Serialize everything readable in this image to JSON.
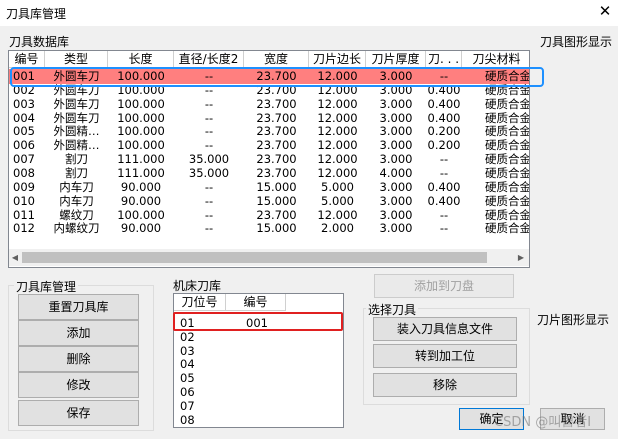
{
  "window": {
    "title": "刀具库管理",
    "close_glyph": "✕"
  },
  "labels": {
    "tool_database": "刀具数据库",
    "tool_graphic": "刀具图形显示",
    "blade_graphic": "刀片图形显示",
    "library_group": "刀具库管理",
    "machine_library": "机床刀库",
    "select_tool_group": "选择刀具"
  },
  "tool_table": {
    "headers": [
      "编号",
      "类型",
      "长度",
      "直径/长度2",
      "宽度",
      "刀片边长",
      "刀片厚度",
      "刀. . .",
      "刀尖材料"
    ],
    "rows": [
      [
        "001",
        "外圆车刀",
        "100.000",
        "--",
        "23.700",
        "12.000",
        "3.000",
        "--",
        "硬质合金"
      ],
      [
        "002",
        "外圆车刀",
        "100.000",
        "--",
        "23.700",
        "12.000",
        "3.000",
        "0.400",
        "硬质合金"
      ],
      [
        "003",
        "外圆车刀",
        "100.000",
        "--",
        "23.700",
        "12.000",
        "3.000",
        "0.400",
        "硬质合金"
      ],
      [
        "004",
        "外圆车刀",
        "100.000",
        "--",
        "23.700",
        "12.000",
        "3.000",
        "0.400",
        "硬质合金"
      ],
      [
        "005",
        "外圆精…",
        "100.000",
        "--",
        "23.700",
        "12.000",
        "3.000",
        "0.200",
        "硬质合金"
      ],
      [
        "006",
        "外圆精…",
        "100.000",
        "--",
        "23.700",
        "12.000",
        "3.000",
        "0.200",
        "硬质合金"
      ],
      [
        "007",
        "割刀",
        "111.000",
        "35.000",
        "23.700",
        "12.000",
        "3.000",
        "--",
        "硬质合金"
      ],
      [
        "008",
        "割刀",
        "111.000",
        "35.000",
        "23.700",
        "12.000",
        "4.000",
        "--",
        "硬质合金"
      ],
      [
        "009",
        "内车刀",
        "90.000",
        "--",
        "15.000",
        "5.000",
        "3.000",
        "0.400",
        "硬质合金"
      ],
      [
        "010",
        "内车刀",
        "90.000",
        "--",
        "15.000",
        "5.000",
        "3.000",
        "0.400",
        "硬质合金"
      ],
      [
        "011",
        "螺纹刀",
        "100.000",
        "--",
        "23.700",
        "12.000",
        "3.000",
        "--",
        "硬质合金"
      ],
      [
        "012",
        "内螺纹刀",
        "90.000",
        "--",
        "15.000",
        "2.000",
        "3.000",
        "--",
        "硬质合金"
      ]
    ]
  },
  "scroll_arrows": {
    "left": "◀",
    "right": "▶"
  },
  "buttons": {
    "reset_library": "重置刀具库",
    "add": "添加",
    "delete": "删除",
    "modify": "修改",
    "save": "保存",
    "add_to_disk": "添加到刀盘",
    "load_tool_file": "装入刀具信息文件",
    "to_station": "转到加工位",
    "remove": "移除",
    "ok": "确定",
    "cancel": "取消"
  },
  "machine_table": {
    "headers": [
      "刀位号",
      "编号"
    ],
    "slots": [
      {
        "slot": "01",
        "code": "001"
      },
      {
        "slot": "02",
        "code": ""
      },
      {
        "slot": "03",
        "code": ""
      },
      {
        "slot": "04",
        "code": ""
      },
      {
        "slot": "05",
        "code": ""
      },
      {
        "slot": "06",
        "code": ""
      },
      {
        "slot": "07",
        "code": ""
      },
      {
        "slot": "08",
        "code": ""
      }
    ]
  },
  "watermark": "CSDN @叫兽者I",
  "colors": {
    "selected_row": "#ff7f7f",
    "highlight_blue": "#1e90ff",
    "highlight_red": "#e02020"
  }
}
